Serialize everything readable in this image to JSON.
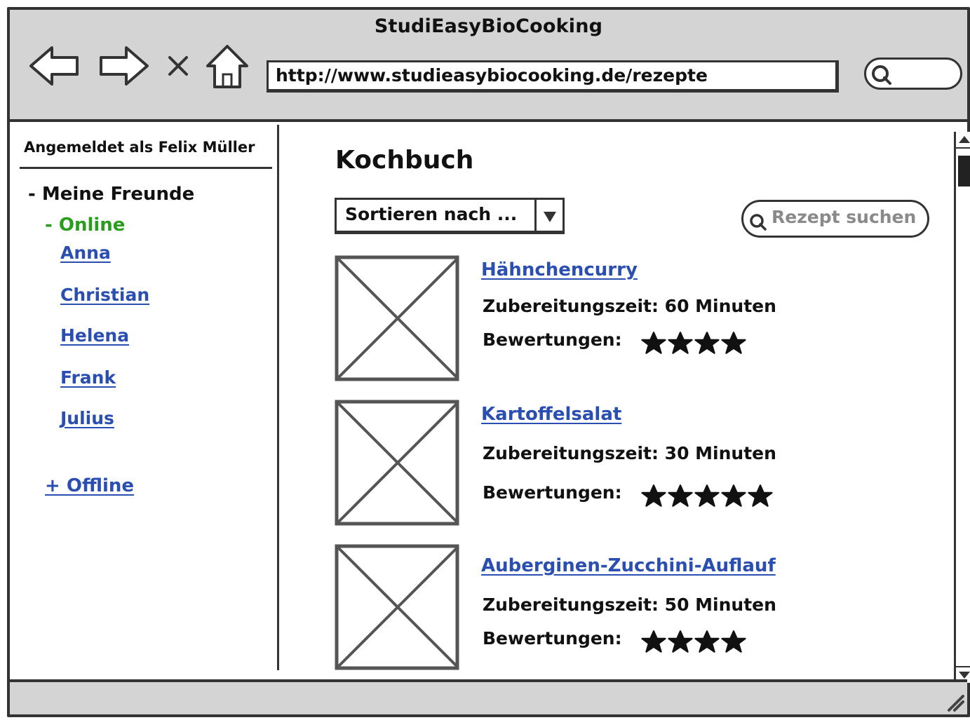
{
  "browser": {
    "title": "StudiEasyBioCooking",
    "url": "http://www.studieasybiocooking.de/rezepte",
    "close_glyph": "X"
  },
  "sidebar": {
    "user_label": "Angemeldet als Felix Müller",
    "friends_heading": "- Meine Freunde",
    "online_heading": "- Online",
    "friends": [
      "Anna",
      "Christian",
      "Helena",
      "Frank",
      "Julius"
    ],
    "offline_label": "+ Offline"
  },
  "main": {
    "title": "Kochbuch",
    "sort_label": "Sortieren nach ...",
    "search_placeholder": "Rezept suchen",
    "recipes": [
      {
        "name": "Hähnchencurry",
        "time": "Zubereitungszeit: 60 Minuten",
        "rating_label": "Bewertungen:",
        "stars": 4
      },
      {
        "name": "Kartoffelsalat",
        "time": "Zubereitungszeit: 30 Minuten",
        "rating_label": "Bewertungen:",
        "stars": 5
      },
      {
        "name": "Auberginen-Zucchini-Auflauf",
        "time": "Zubereitungszeit: 50 Minuten",
        "rating_label": "Bewertungen:",
        "stars": 4
      }
    ]
  },
  "icons": {
    "back": "back-arrow-icon",
    "forward": "forward-arrow-icon",
    "stop": "close-icon",
    "home": "home-icon",
    "search": "search-icon",
    "dropdown": "chevron-down-icon",
    "star": "star-icon",
    "image_placeholder": "image-placeholder-icon"
  },
  "colors": {
    "link": "#2a4fb0",
    "online": "#2a9d1e",
    "chrome": "#d4d4d4",
    "placeholder_text": "#8a8a8a"
  }
}
